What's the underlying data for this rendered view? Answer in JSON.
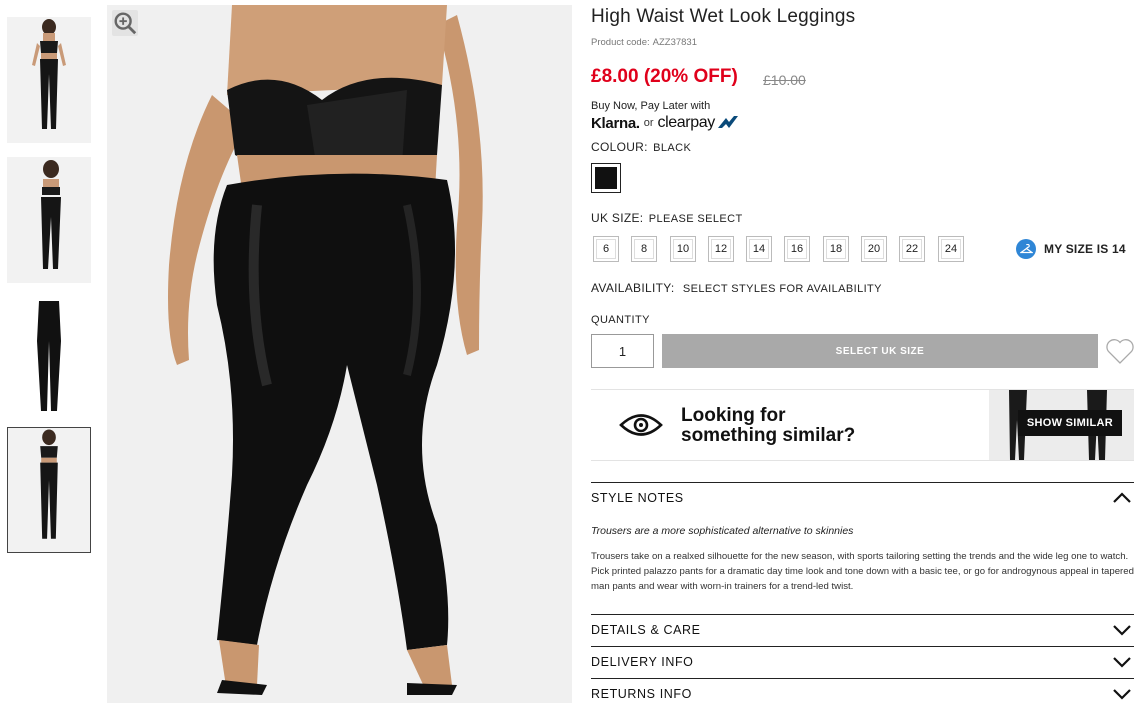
{
  "product": {
    "title": "High Waist Wet Look Leggings",
    "code_label": "Product code:",
    "code": "AZZ37831",
    "price": "£8.00 (20% OFF)",
    "old_price": "£10.00"
  },
  "payment": {
    "bnpl_text": "Buy Now, Pay Later with",
    "klarna": "Klarna.",
    "or": "or",
    "clearpay": "clearpay"
  },
  "colour": {
    "label": "COLOUR:",
    "value": "BLACK",
    "swatch_color": "#111111"
  },
  "size": {
    "label": "UK SIZE:",
    "value": "PLEASE SELECT",
    "options": [
      "6",
      "8",
      "10",
      "12",
      "14",
      "16",
      "18",
      "20",
      "22",
      "24"
    ],
    "my_size": "MY SIZE IS 14"
  },
  "availability": {
    "label": "AVAILABILITY:",
    "value": "SELECT STYLES FOR AVAILABILITY"
  },
  "quantity": {
    "label": "QUANTITY",
    "value": "1"
  },
  "add_button": "SELECT UK SIZE",
  "similar": {
    "line1": "Looking for",
    "line2": "something similar?",
    "button": "SHOW SIMILAR"
  },
  "style_notes": {
    "title": "STYLE NOTES",
    "heading": "Trousers are a more sophisticated alternative to skinnies",
    "body": "Trousers take on a realxed silhouette for the new season, with sports tailoring setting the trends and the wide leg one to watch. Pick printed palazzo pants for a dramatic day time look and tone down with a basic tee, or go for androgynous appeal in tapered man pants and wear with worn-in trainers for a trend-led twist."
  },
  "accordion": {
    "details": "DETAILS & CARE",
    "delivery": "DELIVERY INFO",
    "returns": "RETURNS INFO"
  },
  "icons": {
    "zoom": "zoom-icon",
    "wishlist": "heart-icon",
    "eye": "eye-icon",
    "hanger": "hanger-icon",
    "chevron_up": "chevron-up-icon",
    "chevron_down": "chevron-down-icon"
  },
  "colors": {
    "price": "#e0001b",
    "add_button": "#a9a9a9",
    "my_size_icon": "#2f86d6"
  }
}
